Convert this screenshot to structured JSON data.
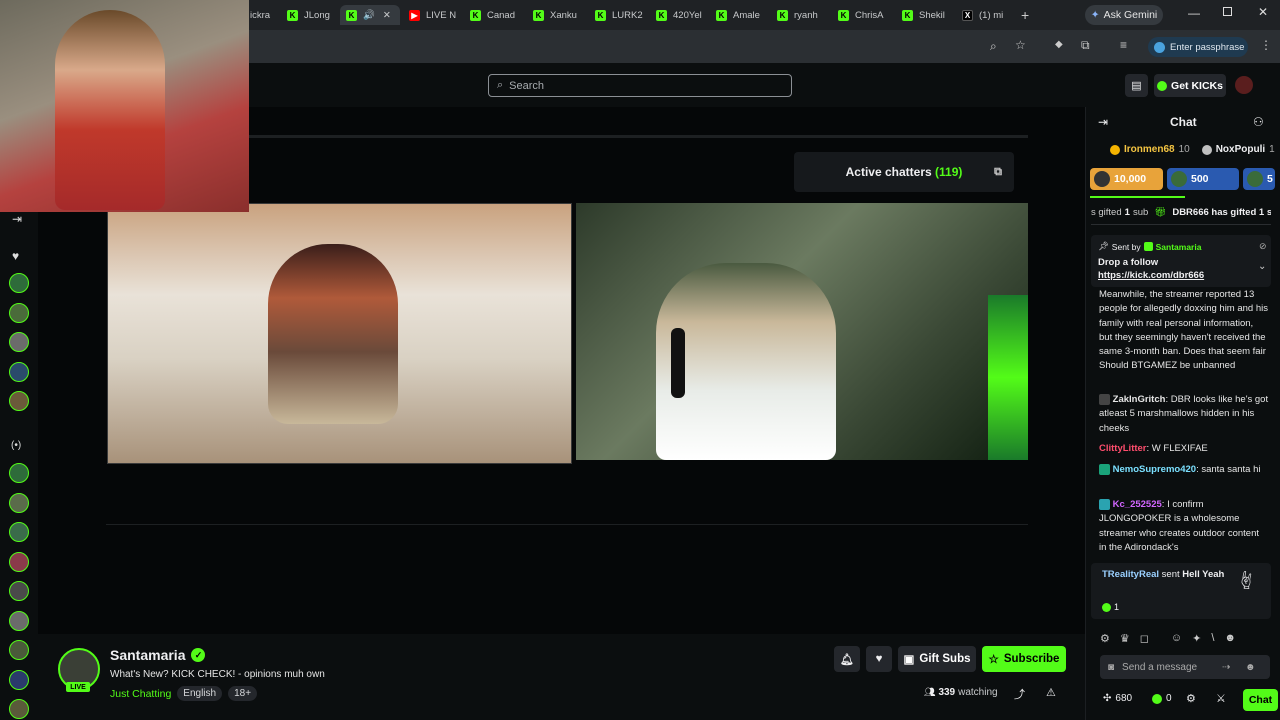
{
  "tabs": [
    {
      "label": "ickra",
      "fav": "K"
    },
    {
      "label": "JLong",
      "fav": "K"
    },
    {
      "label": "",
      "fav": "K"
    },
    {
      "label": "LIVE N",
      "fav": "yt"
    },
    {
      "label": "Canad",
      "fav": "K"
    },
    {
      "label": "Xanku",
      "fav": "K"
    },
    {
      "label": "LURK2",
      "fav": "K"
    },
    {
      "label": "420Yel",
      "fav": "K"
    },
    {
      "label": "Amale",
      "fav": "K"
    },
    {
      "label": "ryanh",
      "fav": "K"
    },
    {
      "label": "ChrisA",
      "fav": "K"
    },
    {
      "label": "Shekil",
      "fav": "K"
    },
    {
      "label": "(1) mi",
      "fav": "X"
    }
  ],
  "browser": {
    "ask_gemini": "Ask Gemini",
    "passphrase": "Enter passphrase"
  },
  "header": {
    "search_placeholder": "Search",
    "get_kicks": "Get KICKs"
  },
  "player": {
    "active_chatters_label": "Active chatters",
    "active_chatters_count": "(119)"
  },
  "channel": {
    "name": "Santamaria",
    "live": "LIVE",
    "title": "What's New? KICK CHECK! - opinions muh own",
    "category": "Just Chatting",
    "tags": [
      "English",
      "18+"
    ],
    "watching_count": "339",
    "watching_label": "watching",
    "gift_subs": "Gift Subs",
    "subscribe": "Subscribe"
  },
  "chat": {
    "title": "Chat",
    "top": [
      {
        "name": "Ironmen68",
        "count": "10"
      },
      {
        "name": "NoxPopuli",
        "count": "1"
      }
    ],
    "goals": [
      "10,000",
      "500",
      "5"
    ],
    "ticker_a_prefix": "s gifted",
    "ticker_a_count": "1",
    "ticker_a_suffix": "sub",
    "ticker_b": "DBR666 has gifted 1 s",
    "pinned": {
      "sent_by": "Sent by",
      "user": "Santamaria",
      "text": "Drop a follow",
      "link": "https://kick.com/dbr666"
    },
    "msg0": "Meanwhile, the streamer reported 13 people for allegedly doxxing him and his family with real personal information, but they seemingly haven't received the same 3-month ban. Does that seem fair Should BTGAMEZ be unbanned",
    "messages": [
      {
        "user": "ZakInGritch",
        "color": "#e6e6e6",
        "text": "DBR looks like he's got atleast 5 marshmallows hidden in his cheeks"
      },
      {
        "user": "ClittyLitter",
        "color": "#ff4d6d",
        "text": "W FLEXIFAE"
      },
      {
        "user": "NemoSupremo420",
        "color": "#7be0ff",
        "text": "santa santa hi"
      },
      {
        "user": "Kc_252525",
        "color": "#d266ff",
        "text": "I confirm JLONGOPOKER is a wholesome streamer who creates outdoor content in the Adirondack's"
      }
    ],
    "gift": {
      "user": "TRealityReal",
      "action": "sent",
      "item": "Hell Yeah",
      "count": "1"
    },
    "send_placeholder": "Send a message",
    "points": "680",
    "kicks": "0",
    "chat_button": "Chat"
  }
}
